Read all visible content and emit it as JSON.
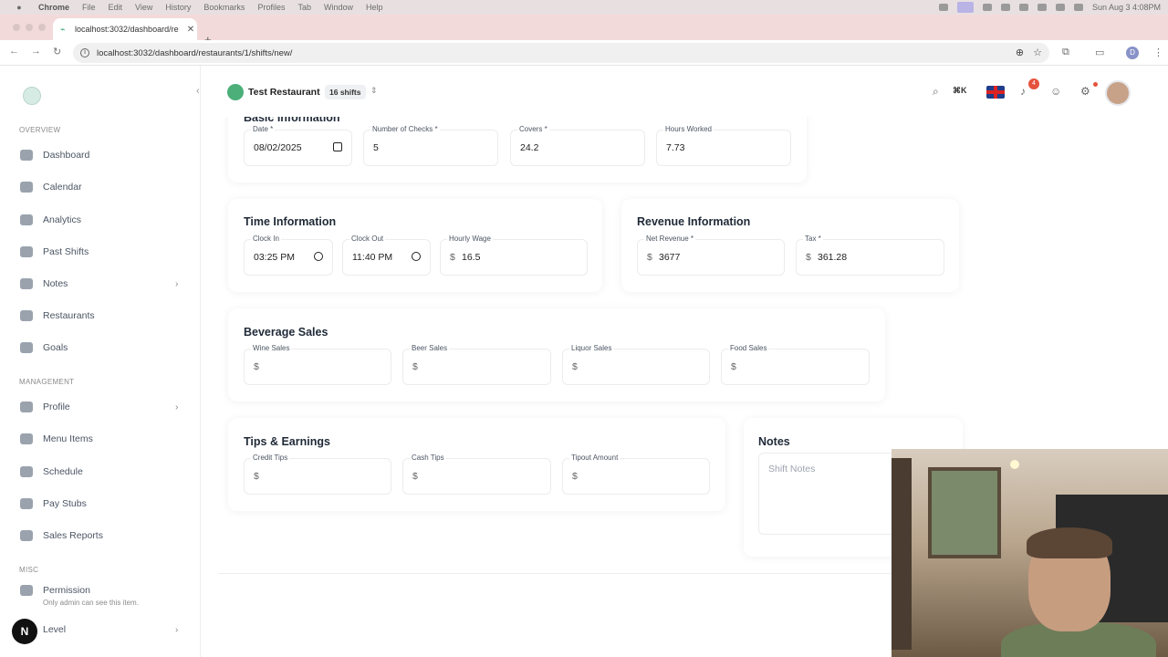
{
  "menubar": {
    "items": [
      "Chrome",
      "File",
      "Edit",
      "View",
      "History",
      "Bookmarks",
      "Profiles",
      "Tab",
      "Window",
      "Help"
    ],
    "datetime": "Sun Aug 3  4:08PM"
  },
  "browser": {
    "tab_title": "localhost:3032/dashboard/re",
    "url": "localhost:3032/dashboard/restaurants/1/shifts/new/",
    "profile_initial": "D"
  },
  "sidebar": {
    "sections": {
      "overview": "OVERVIEW",
      "management": "MANAGEMENT",
      "misc": "MISC"
    },
    "items": [
      {
        "label": "Dashboard",
        "icon": "dashboard-icon"
      },
      {
        "label": "Calendar",
        "icon": "calendar-icon"
      },
      {
        "label": "Analytics",
        "icon": "analytics-icon"
      },
      {
        "label": "Past Shifts",
        "icon": "past-shifts-icon"
      },
      {
        "label": "Notes",
        "icon": "notes-icon"
      },
      {
        "label": "Restaurants",
        "icon": "restaurants-icon"
      },
      {
        "label": "Goals",
        "icon": "goals-icon"
      },
      {
        "label": "Profile",
        "icon": "profile-icon"
      },
      {
        "label": "Menu Items",
        "icon": "menu-items-icon"
      },
      {
        "label": "Schedule",
        "icon": "schedule-icon"
      },
      {
        "label": "Pay Stubs",
        "icon": "pay-stubs-icon"
      },
      {
        "label": "Sales Reports",
        "icon": "sales-reports-icon"
      },
      {
        "label": "Permission",
        "icon": "permission-icon"
      },
      {
        "label": "Level",
        "icon": "level-icon"
      }
    ],
    "permission_sub": "Only admin can see this item.",
    "n_badge": "N"
  },
  "topbar": {
    "restaurant_name": "Test Restaurant",
    "shift_count": "16 shifts",
    "shortcut": "⌘K",
    "notification_count": "4"
  },
  "basic": {
    "title": "Basic Information",
    "date_label": "Date *",
    "date_value": "08/02/2025",
    "checks_label": "Number of Checks *",
    "checks_value": "5",
    "covers_label": "Covers *",
    "covers_value": "24.2",
    "hours_label": "Hours Worked",
    "hours_value": "7.73"
  },
  "time": {
    "title": "Time Information",
    "clock_in_label": "Clock In",
    "clock_in_value": "03:25 PM",
    "clock_out_label": "Clock Out",
    "clock_out_value": "11:40 PM",
    "wage_label": "Hourly Wage",
    "wage_value": "16.5"
  },
  "revenue": {
    "title": "Revenue Information",
    "net_label": "Net Revenue *",
    "net_value": "3677",
    "tax_label": "Tax *",
    "tax_value": "361.28"
  },
  "beverage": {
    "title": "Beverage Sales",
    "wine_label": "Wine Sales",
    "beer_label": "Beer Sales",
    "liquor_label": "Liquor Sales",
    "food_label": "Food Sales"
  },
  "tips": {
    "title": "Tips & Earnings",
    "credit_label": "Credit Tips",
    "cash_label": "Cash Tips",
    "tipout_label": "Tipout Amount"
  },
  "notes": {
    "title": "Notes",
    "placeholder": "Shift Notes"
  },
  "currency": "$"
}
